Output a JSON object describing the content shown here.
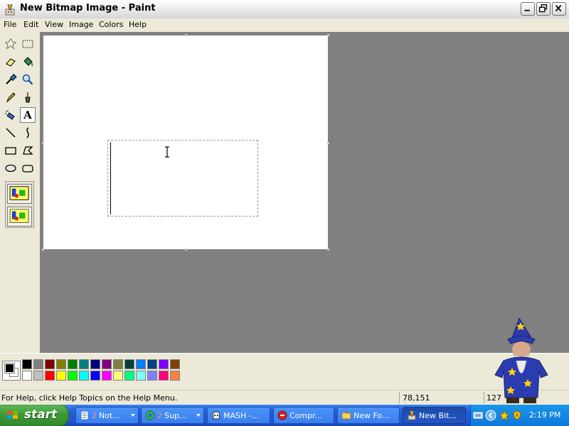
{
  "window": {
    "title": "New Bitmap Image - Paint",
    "icon": "paint-brush-icon"
  },
  "menu": [
    "File",
    "Edit",
    "View",
    "Image",
    "Colors",
    "Help"
  ],
  "tools": [
    {
      "name": "free-form-select",
      "icon": "free-form-select-icon"
    },
    {
      "name": "rectangle-select",
      "icon": "rectangle-select-icon"
    },
    {
      "name": "eraser",
      "icon": "eraser-icon"
    },
    {
      "name": "fill-with-color",
      "icon": "fill-bucket-icon"
    },
    {
      "name": "pick-color",
      "icon": "eyedropper-icon"
    },
    {
      "name": "magnifier",
      "icon": "magnifier-icon"
    },
    {
      "name": "pencil",
      "icon": "pencil-icon"
    },
    {
      "name": "brush",
      "icon": "brush-icon"
    },
    {
      "name": "airbrush",
      "icon": "airbrush-icon"
    },
    {
      "name": "text",
      "icon": "text-icon",
      "glyph": "A",
      "active": true
    },
    {
      "name": "line",
      "icon": "line-icon"
    },
    {
      "name": "curve",
      "icon": "curve-icon"
    },
    {
      "name": "rectangle",
      "icon": "rectangle-icon"
    },
    {
      "name": "polygon",
      "icon": "polygon-icon"
    },
    {
      "name": "ellipse",
      "icon": "ellipse-icon"
    },
    {
      "name": "rounded-rectangle",
      "icon": "rounded-rectangle-icon"
    }
  ],
  "tool_options": [
    "opaque-background-icon",
    "transparent-background-icon"
  ],
  "palette": {
    "foreground": "#000000",
    "background": "#ffffff",
    "row1": [
      "#000000",
      "#808080",
      "#800000",
      "#808000",
      "#008000",
      "#008080",
      "#000080",
      "#800080",
      "#808040",
      "#004040",
      "#0080ff",
      "#004080",
      "#8000ff",
      "#804000"
    ],
    "row2": [
      "#ffffff",
      "#c0c0c0",
      "#ff0000",
      "#ffff00",
      "#00ff00",
      "#00ffff",
      "#0000ff",
      "#ff00ff",
      "#ffff80",
      "#00ff80",
      "#80ffff",
      "#8080ff",
      "#ff0080",
      "#ff8040"
    ]
  },
  "status": {
    "help": "For Help, click Help Topics on the Help Menu.",
    "coords": "78,151",
    "size": "127"
  },
  "taskbar": {
    "start": "start",
    "tasks": [
      {
        "count": "2",
        "label": "Not...",
        "icon": "notepad-icon",
        "has_arrow": true
      },
      {
        "count": "2",
        "label": "Sup...",
        "icon": "messenger-icon",
        "has_arrow": true
      },
      {
        "count": "",
        "label": "MASH -...",
        "icon": "mash-icon",
        "has_arrow": false
      },
      {
        "count": "",
        "label": "Compr...",
        "icon": "compress-icon",
        "has_arrow": false
      },
      {
        "count": "",
        "label": "New Fo...",
        "icon": "folder-icon",
        "has_arrow": false
      },
      {
        "count": "",
        "label": "New Bit...",
        "icon": "paint-brush-icon",
        "has_arrow": false,
        "active": true
      }
    ],
    "clock": "2:19 PM"
  }
}
